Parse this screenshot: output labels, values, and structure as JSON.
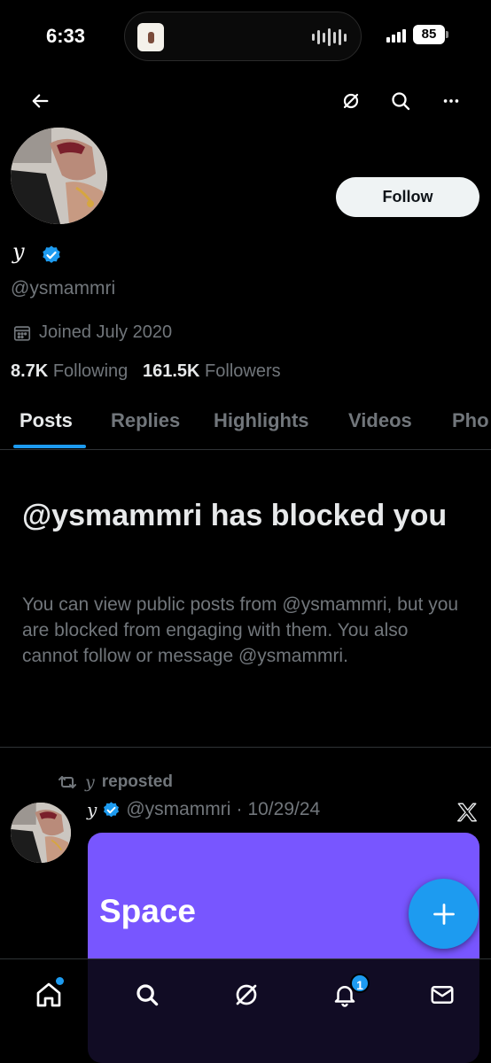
{
  "status_bar": {
    "time": "6:33",
    "battery": "85"
  },
  "header": {
    "icons": [
      "back-arrow-icon",
      "grok-icon",
      "search-icon",
      "more-icon"
    ]
  },
  "profile": {
    "display_name": "y",
    "verified": true,
    "handle": "@ysmammri",
    "joined": "Joined July 2020",
    "following_count": "8.7K",
    "following_label": "Following",
    "followers_count": "161.5K",
    "followers_label": "Followers",
    "follow_label": "Follow"
  },
  "tabs": [
    {
      "label": "Posts",
      "active": true
    },
    {
      "label": "Replies",
      "active": false
    },
    {
      "label": "Highlights",
      "active": false
    },
    {
      "label": "Videos",
      "active": false
    },
    {
      "label": "Pho",
      "active": false
    }
  ],
  "blocked": {
    "title": "@ysmammri has blocked you",
    "body": "You can view public posts from @ysmammri, but you are blocked from engaging with them. You also cannot follow or message @ysmammri."
  },
  "post": {
    "repost_name": "y",
    "repost_text": "reposted",
    "author_name": "y",
    "author_handle": "@ysmammri",
    "separator": "·",
    "date": "10/29/24",
    "card_label": "Space"
  },
  "colors": {
    "accent": "#1d9bf0",
    "space_card": "#7856ff",
    "secondary_text": "#71767b"
  },
  "bottom_nav": {
    "notification_count": "1"
  }
}
